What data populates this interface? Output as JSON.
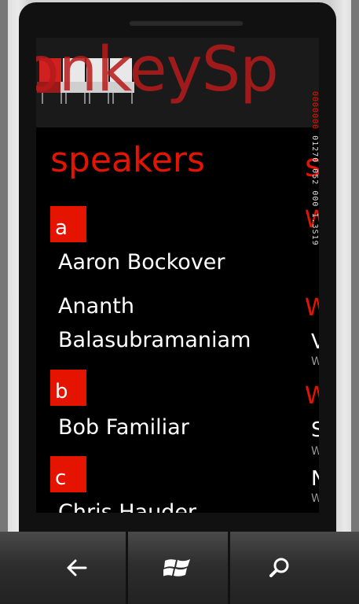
{
  "app": {
    "header_title": "onkeySp",
    "page_title": "speakers",
    "next_page_peek": "s"
  },
  "speakers": {
    "groups": [
      {
        "letter": "a",
        "names": [
          "Aaron Bockover",
          "Ananth",
          "Balasubramaniam"
        ]
      },
      {
        "letter": "b",
        "names": [
          "Bob Familiar"
        ]
      },
      {
        "letter": "c",
        "names": [
          "Chris Hauder"
        ]
      }
    ]
  },
  "peek_column": {
    "red_1": "W",
    "red_2": "W",
    "white_1": "V",
    "grey_1": "W",
    "red_3": "W",
    "white_2": "S",
    "grey_2": "W",
    "white_3": "N",
    "grey_3": "W"
  },
  "debug_overlay": {
    "line1": "01270 052 000 1.3S19",
    "line2": "0000000"
  },
  "navbar": {
    "back_icon": "back-arrow-icon",
    "start_icon": "windows-logo-icon",
    "search_icon": "search-icon"
  },
  "colors": {
    "accent": "#e51400",
    "background": "#000000"
  }
}
